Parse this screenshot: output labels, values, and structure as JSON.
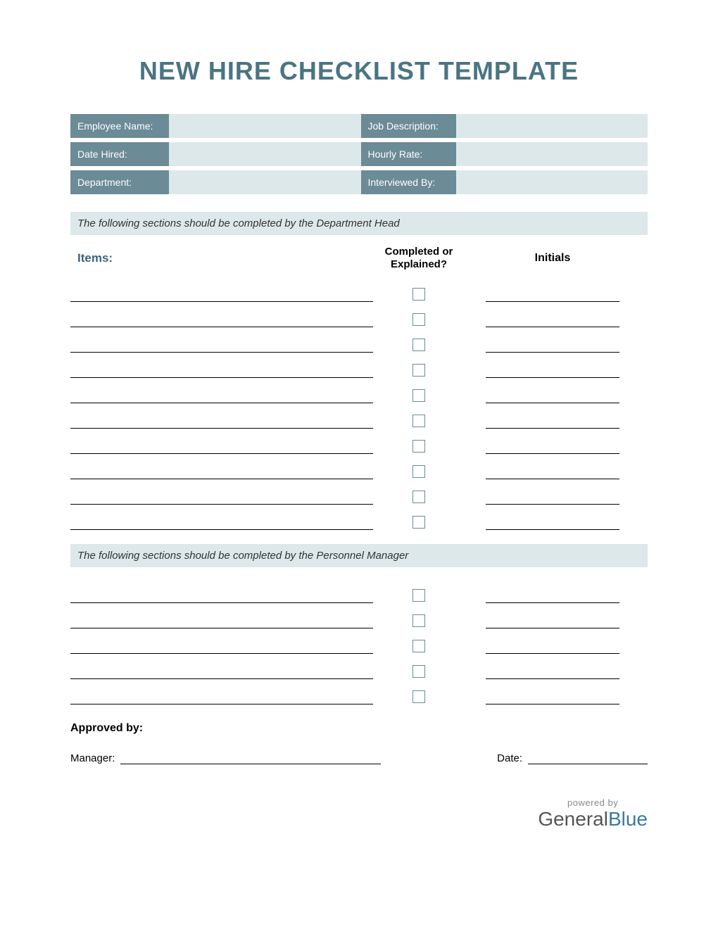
{
  "title": "NEW HIRE CHECKLIST TEMPLATE",
  "info": {
    "employee_name_label": "Employee Name:",
    "job_description_label": "Job Description:",
    "date_hired_label": "Date Hired:",
    "hourly_rate_label": "Hourly Rate:",
    "department_label": "Department:",
    "interviewed_by_label": "Interviewed By:"
  },
  "section1_note": "The following sections should be completed by the Department Head",
  "headers": {
    "items": "Items:",
    "completed": "Completed or Explained?",
    "initials": "Initials"
  },
  "section1_row_count": 10,
  "section2_note": "The following sections should be completed by the Personnel Manager",
  "section2_row_count": 5,
  "approved_label": "Approved by:",
  "signoff": {
    "manager_label": "Manager:",
    "date_label": "Date:"
  },
  "footer": {
    "powered": "powered by",
    "brand1": "General",
    "brand2": "Blue"
  }
}
